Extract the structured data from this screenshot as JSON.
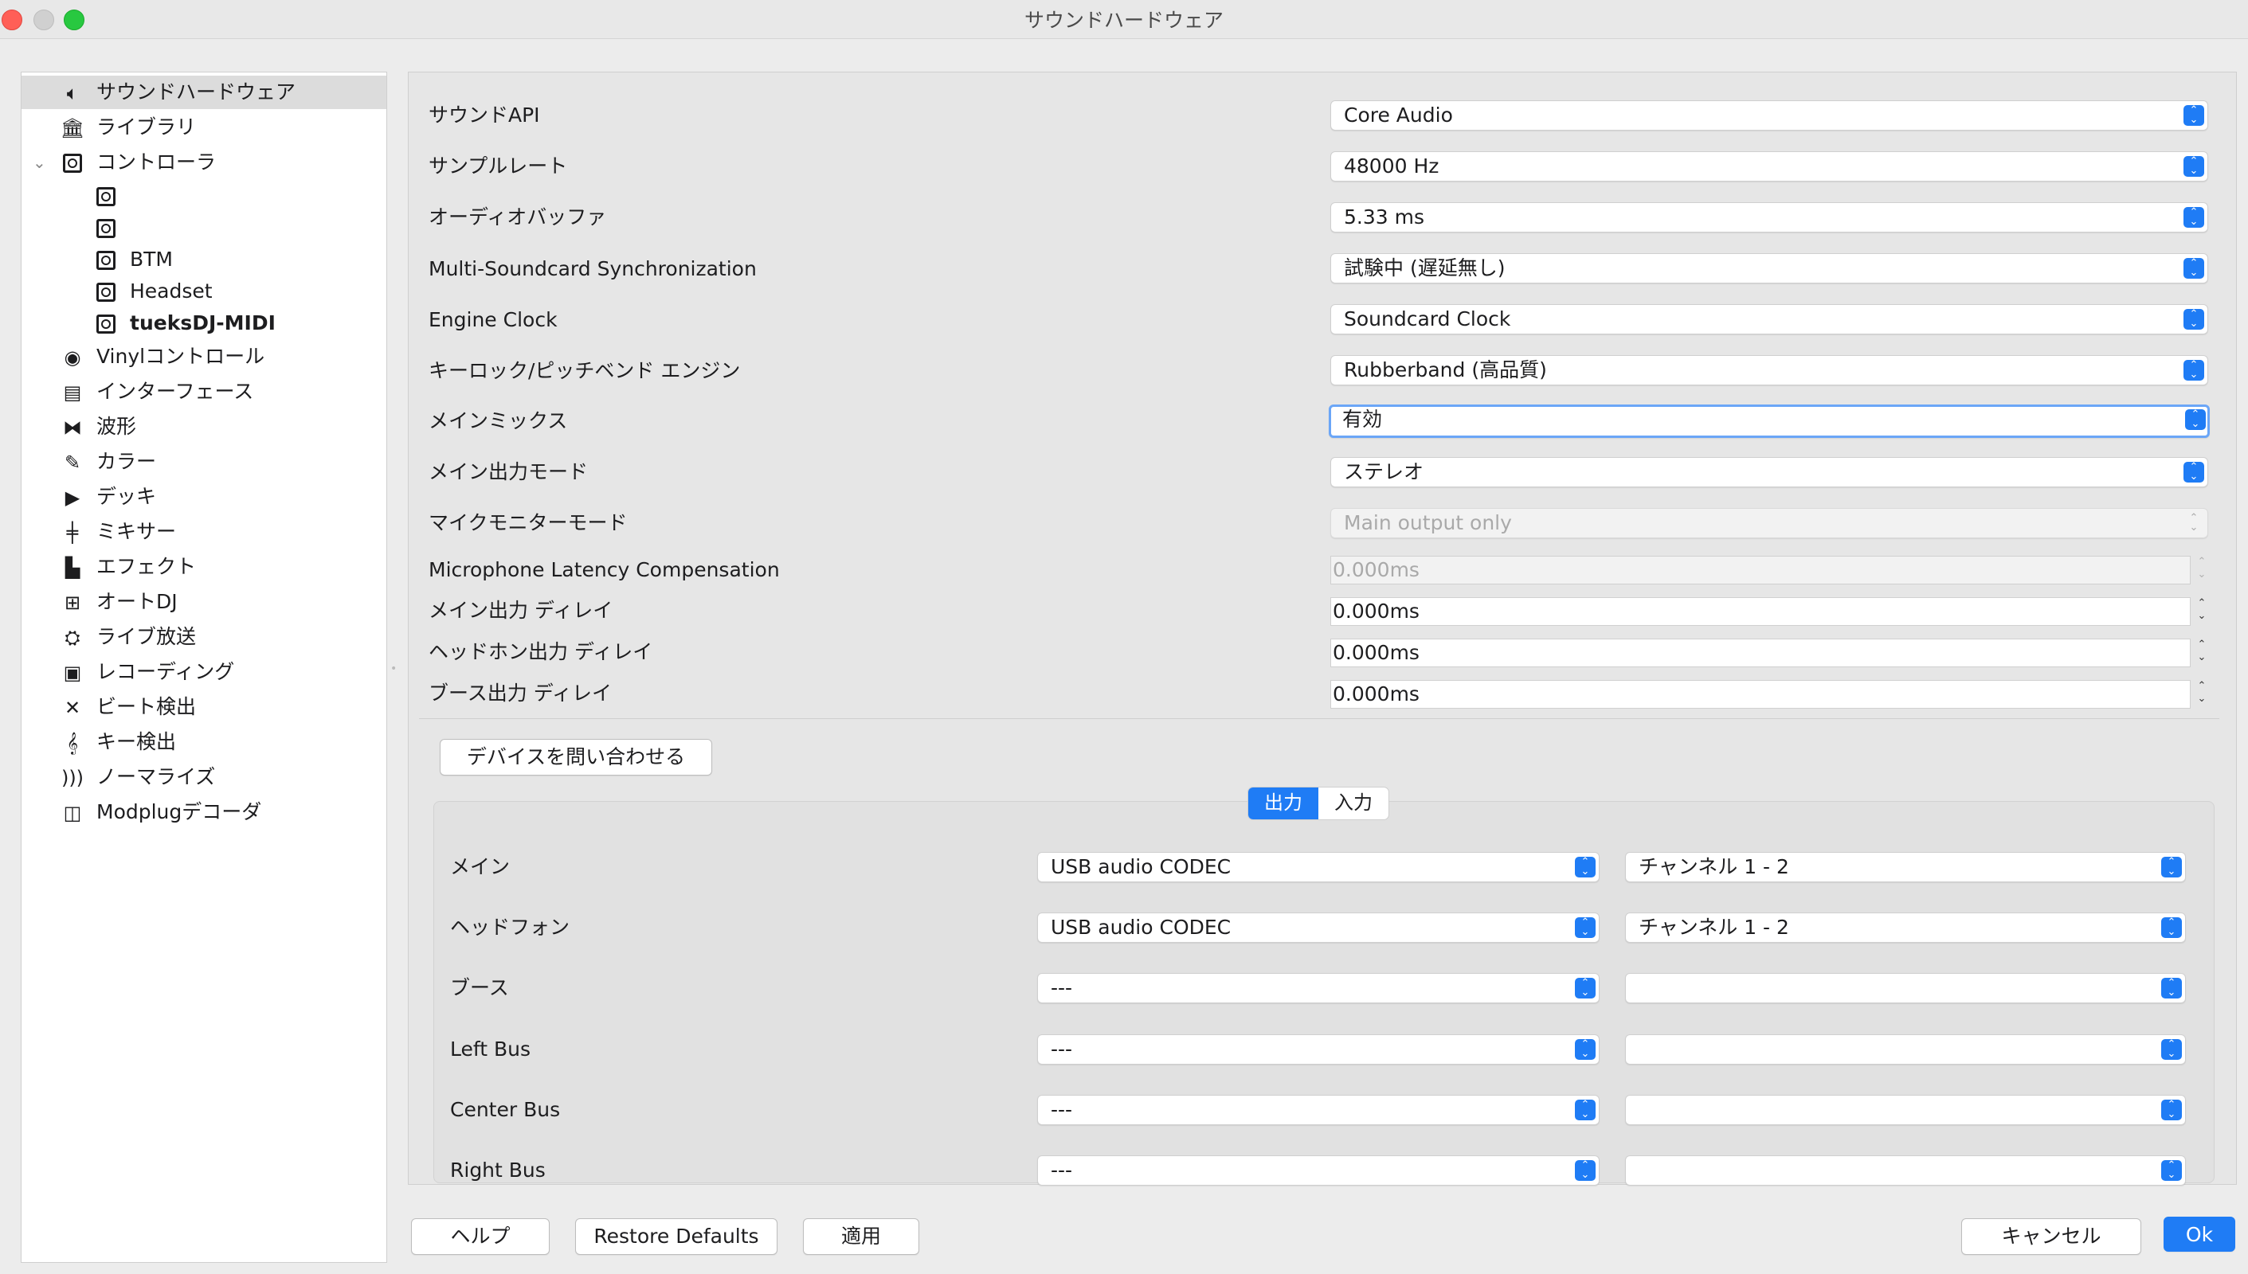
{
  "window": {
    "title": "サウンドハードウェア"
  },
  "sidebar": {
    "items": [
      {
        "label": "サウンドハードウェア",
        "icon": "speaker-icon"
      },
      {
        "label": "ライブラリ",
        "icon": "library-icon"
      },
      {
        "label": "コントローラ",
        "icon": "controller-icon"
      },
      {
        "label": "",
        "icon": "controller-icon"
      },
      {
        "label": "",
        "icon": "controller-icon"
      },
      {
        "label": "BTM",
        "icon": "controller-icon"
      },
      {
        "label": "Headset",
        "icon": "controller-icon"
      },
      {
        "label": "tueksDJ-MIDI",
        "icon": "controller-icon"
      },
      {
        "label": "Vinylコントロール",
        "icon": "vinyl-icon"
      },
      {
        "label": "インターフェース",
        "icon": "interface-icon"
      },
      {
        "label": "波形",
        "icon": "waveform-icon"
      },
      {
        "label": "カラー",
        "icon": "color-icon"
      },
      {
        "label": "デッキ",
        "icon": "play-icon"
      },
      {
        "label": "ミキサー",
        "icon": "mixer-icon"
      },
      {
        "label": "エフェクト",
        "icon": "effects-icon"
      },
      {
        "label": "オートDJ",
        "icon": "robot-icon"
      },
      {
        "label": "ライブ放送",
        "icon": "broadcast-icon"
      },
      {
        "label": "レコーディング",
        "icon": "recording-icon"
      },
      {
        "label": "ビート検出",
        "icon": "beat-icon"
      },
      {
        "label": "キー検出",
        "icon": "key-icon"
      },
      {
        "label": "ノーマライズ",
        "icon": "normalize-icon"
      },
      {
        "label": "Modplugデコーダ",
        "icon": "modplug-icon"
      }
    ]
  },
  "settings": {
    "sound_api": {
      "label": "サウンドAPI",
      "value": "Core Audio"
    },
    "sample_rate": {
      "label": "サンプルレート",
      "value": "48000 Hz"
    },
    "audio_buffer": {
      "label": "オーディオバッファ",
      "value": "5.33 ms"
    },
    "multi_sync": {
      "label": "Multi-Soundcard Synchronization",
      "value": "試験中 (遅延無し)"
    },
    "engine_clock": {
      "label": "Engine Clock",
      "value": "Soundcard Clock"
    },
    "keylock": {
      "label": "キーロック/ピッチベンド エンジン",
      "value": "Rubberband (高品質)"
    },
    "main_mix": {
      "label": "メインミックス",
      "value": "有効"
    },
    "main_output_mode": {
      "label": "メイン出力モード",
      "value": "ステレオ"
    },
    "mic_monitor_mode": {
      "label": "マイクモニターモード",
      "value": "Main output only"
    },
    "mic_latency": {
      "label": "Microphone Latency Compensation",
      "value": "0.000ms"
    },
    "main_delay": {
      "label": "メイン出力 ディレイ",
      "value": "0.000ms"
    },
    "headphone_delay": {
      "label": "ヘッドホン出力 ディレイ",
      "value": "0.000ms"
    },
    "booth_delay": {
      "label": "ブース出力 ディレイ",
      "value": "0.000ms"
    }
  },
  "query_button": "デバイスを問い合わせる",
  "tabs": {
    "output": "出力",
    "input": "入力"
  },
  "outputs": [
    {
      "label": "メイン",
      "device": "USB audio CODEC",
      "channel": "チャンネル 1 - 2"
    },
    {
      "label": "ヘッドフォン",
      "device": "USB audio CODEC",
      "channel": "チャンネル 1 - 2"
    },
    {
      "label": "ブース",
      "device": "---",
      "channel": ""
    },
    {
      "label": "Left Bus",
      "device": "---",
      "channel": ""
    },
    {
      "label": "Center Bus",
      "device": "---",
      "channel": ""
    },
    {
      "label": "Right Bus",
      "device": "---",
      "channel": ""
    }
  ],
  "footer": {
    "help": "ヘルプ",
    "restore": "Restore Defaults",
    "apply": "適用",
    "cancel": "キャンセル",
    "ok": "Ok"
  },
  "colors": {
    "accent": "#1f7cf5"
  }
}
